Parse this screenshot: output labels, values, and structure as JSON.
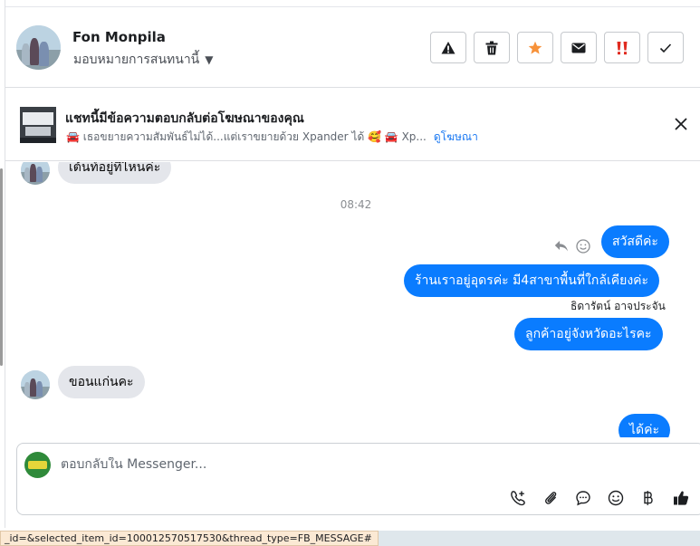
{
  "header": {
    "contact_name": "Fon Monpila",
    "assign_label": "มอบหมายการสนทนานี้",
    "actions": [
      {
        "name": "report-button",
        "icon": "warning-icon"
      },
      {
        "name": "delete-button",
        "icon": "trash-icon"
      },
      {
        "name": "star-button",
        "icon": "star-icon"
      },
      {
        "name": "mark-unread-button",
        "icon": "envelope-icon"
      },
      {
        "name": "spam-button",
        "icon": "exclamation-icon"
      },
      {
        "name": "done-button",
        "icon": "check-icon"
      }
    ],
    "star_color": "#f7923a",
    "spam_color": "#e02a1f"
  },
  "ad_banner": {
    "title": "แชทนี้มีข้อความตอบกลับต่อโฆษณาของคุณ",
    "preview_1": "🚘 เธอขยายความสัมพันธ์ไม่ได้...แต่เราขยายด้วย Xpander ได้ 🥰 🚘 Xp...",
    "link": "ดูโฆษณา"
  },
  "messages": {
    "m1": "เต้นท์อยู่ที่ไหนค่ะ",
    "timestamp": "08:42",
    "m2": "สวัสดีค่ะ",
    "m3": "ร้านเราอยู่อุดรค่ะ มี4สาขาพื้นที่ใกล้เคียงค่ะ",
    "sender": "ธิดารัตน์ อาจประจัน",
    "m4": "ลูกค้าอยู่จังหวัดอะไรคะ",
    "m5": "ขอนแก่นคะ",
    "m6": "ได้ค่ะ"
  },
  "composer": {
    "placeholder": "ตอบกลับใน Messenger...",
    "tools": [
      "call-request-icon",
      "attachment-icon",
      "saved-reply-icon",
      "emoji-icon",
      "baht-icon",
      "thumbs-up-icon"
    ]
  },
  "status_bar": {
    "url": "_id=&selected_item_id=100012570517530&thread_type=FB_MESSAGE#"
  },
  "colors": {
    "outgoing_bubble": "#0a7cff",
    "incoming_bubble": "#e4e6eb",
    "link": "#1877f2"
  }
}
